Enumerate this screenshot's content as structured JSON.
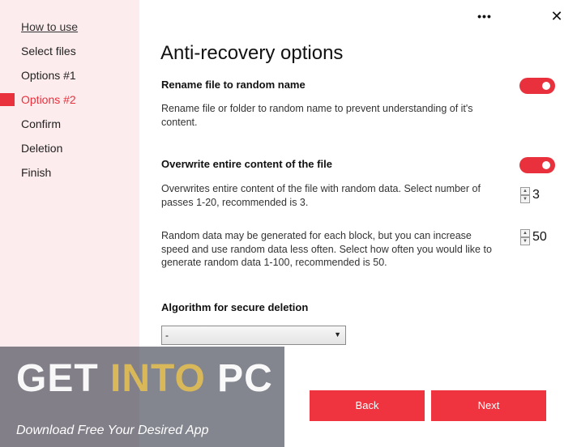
{
  "sidebar": {
    "items": [
      {
        "label": "How to use",
        "state": "link"
      },
      {
        "label": "Select files",
        "state": "normal"
      },
      {
        "label": "Options #1",
        "state": "normal"
      },
      {
        "label": "Options #2",
        "state": "active"
      },
      {
        "label": "Confirm",
        "state": "normal"
      },
      {
        "label": "Deletion",
        "state": "normal"
      },
      {
        "label": "Finish",
        "state": "normal"
      }
    ]
  },
  "topbar": {
    "more_glyph": "•••",
    "close_glyph": "✕"
  },
  "main": {
    "title": "Anti-recovery options",
    "rename": {
      "title": "Rename file to random name",
      "description": "Rename file or folder to random name to prevent understanding of it's content.",
      "enabled": true
    },
    "overwrite": {
      "title": "Overwrite entire content of the file",
      "enabled": true,
      "passes_description": "Overwrites entire content of the file with random data. Select number of passes 1-20, recommended is 3.",
      "passes_value": "3",
      "block_description": "Random data may be generated for each block, but you can increase speed and use random data less often. Select how often you would like to generate random data 1-100, recommended is 50.",
      "block_value": "50"
    },
    "algorithm": {
      "title": "Algorithm for secure deletion",
      "selected": "-"
    }
  },
  "buttons": {
    "back": "Back",
    "next": "Next"
  },
  "watermark": {
    "word1": "GET",
    "word2": "INTO",
    "word3": "PC",
    "subtitle": "Download Free Your Desired App"
  },
  "colors": {
    "accent": "#e8313d",
    "sidebar_bg": "#fdeced",
    "button_bg": "#f0343f"
  }
}
